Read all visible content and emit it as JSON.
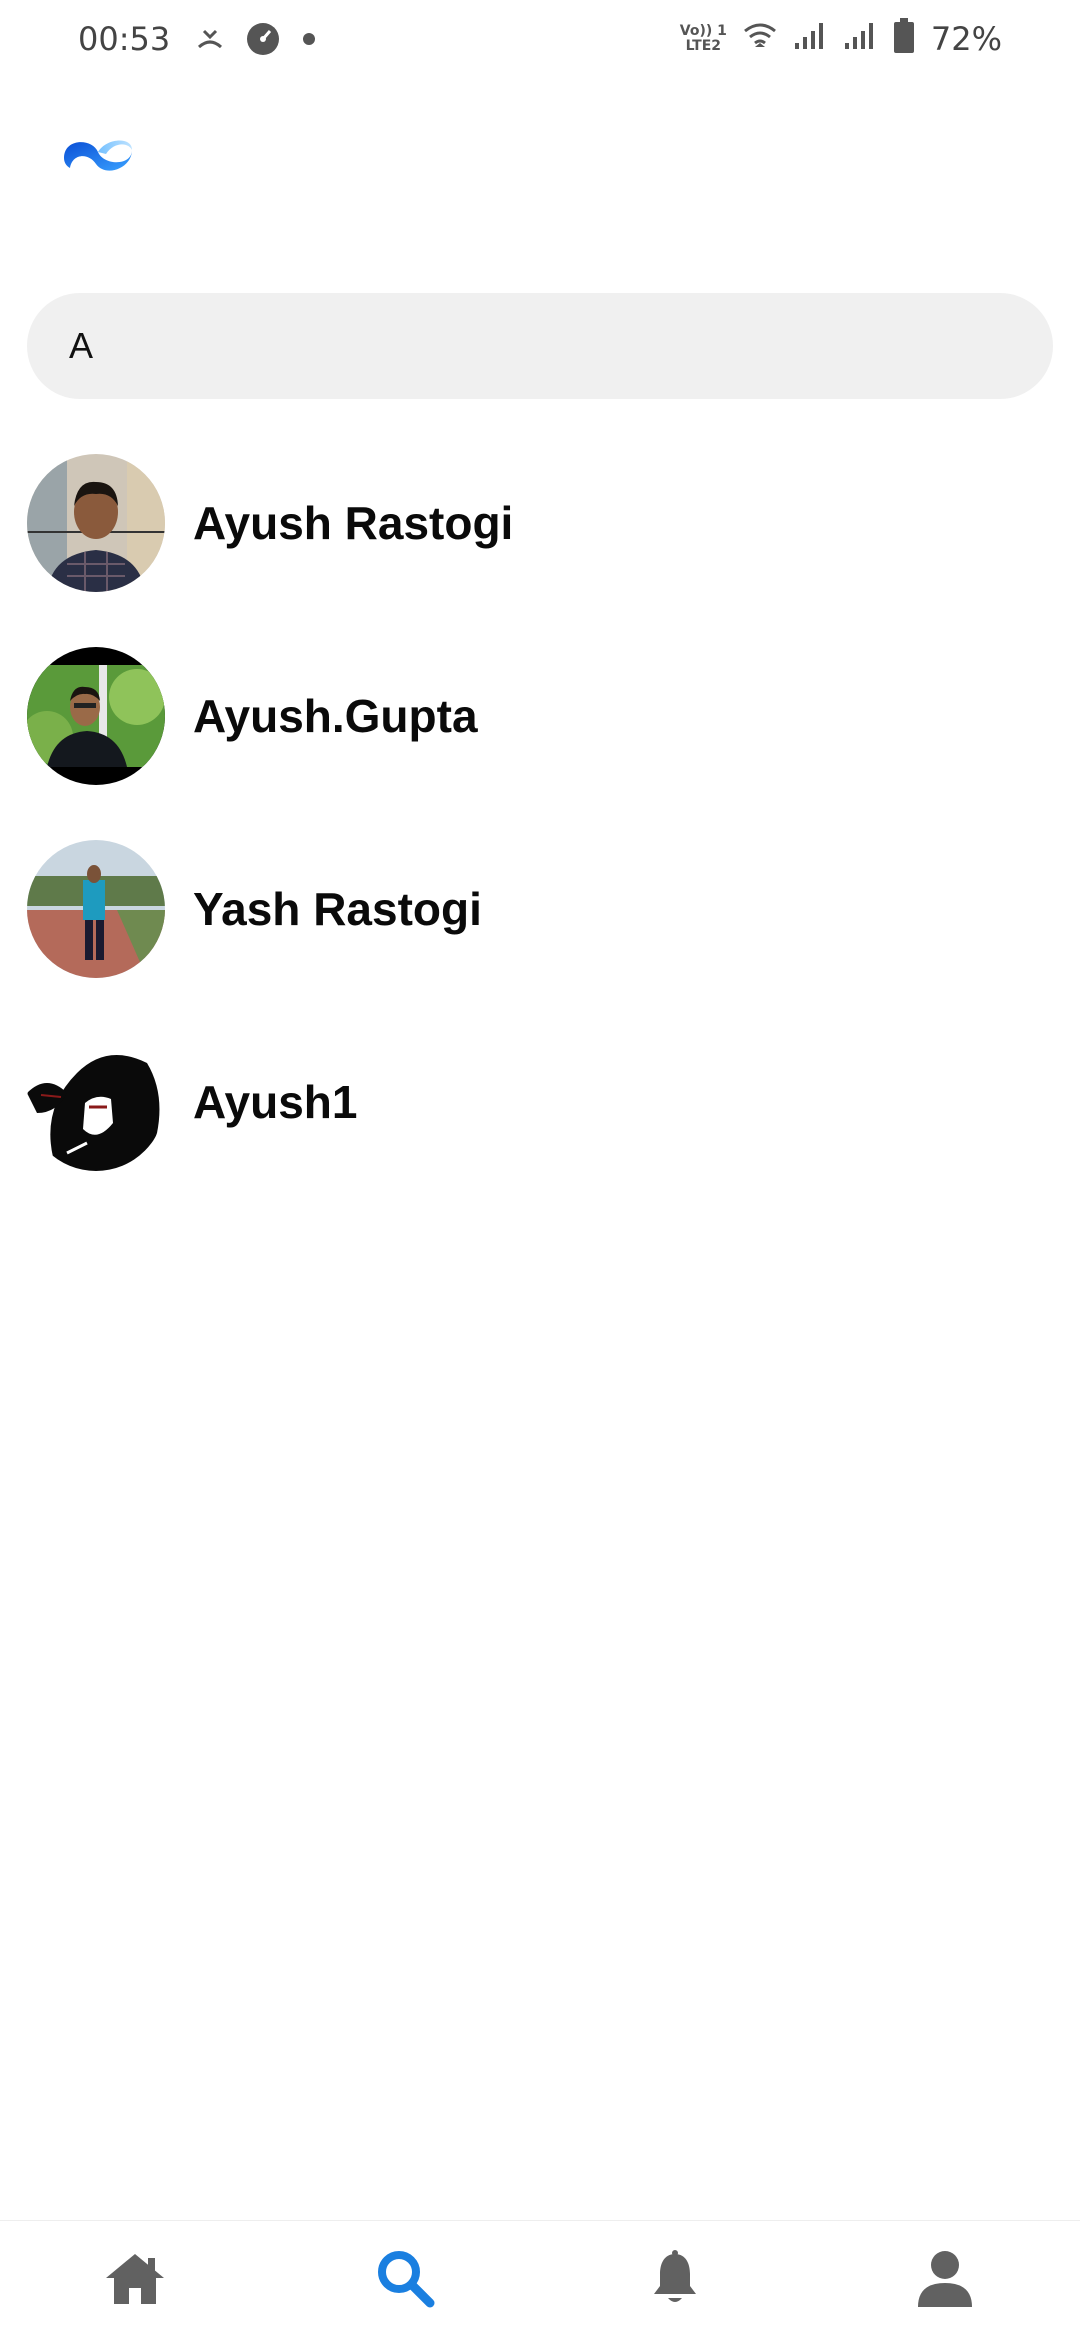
{
  "status_bar": {
    "time": "00:53",
    "network_label_top": "Vo)) 1",
    "network_label_bottom": "LTE2",
    "battery": "72%"
  },
  "search": {
    "value": "A",
    "placeholder": ""
  },
  "results": [
    {
      "name": "Ayush Rastogi",
      "avatar": "photo-man-checked-shirt"
    },
    {
      "name": "Ayush.Gupta",
      "avatar": "photo-man-green-background"
    },
    {
      "name": "Yash Rastogi",
      "avatar": "photo-man-standing-park"
    },
    {
      "name": "Ayush1",
      "avatar": "anime-character-drawing"
    }
  ],
  "bottom_nav": {
    "items": [
      {
        "icon": "home-icon",
        "active": false
      },
      {
        "icon": "search-icon",
        "active": true
      },
      {
        "icon": "bell-icon",
        "active": false
      },
      {
        "icon": "profile-icon",
        "active": false
      }
    ]
  },
  "colors": {
    "accent": "#1a7fe0",
    "nav_inactive": "#616161",
    "search_bg": "#f0f0f0"
  }
}
